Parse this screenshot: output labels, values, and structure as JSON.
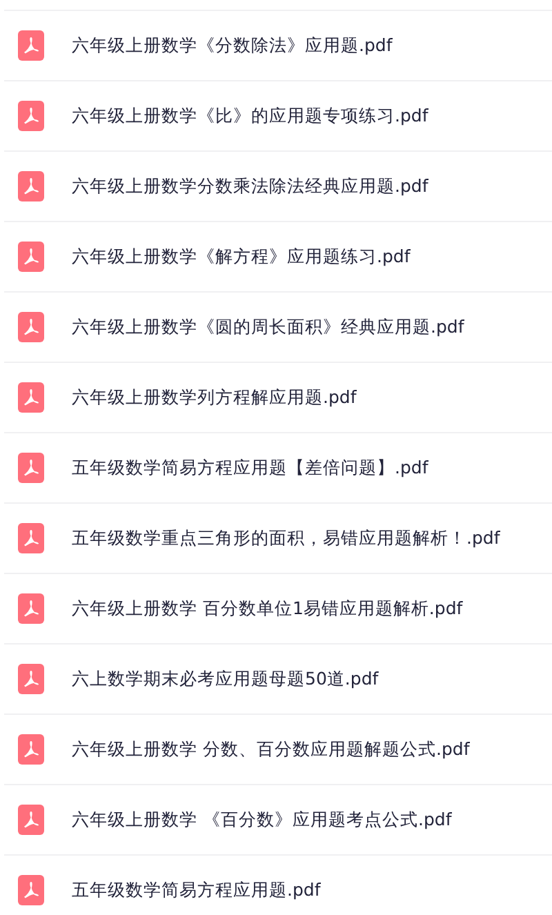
{
  "files": [
    {
      "name": "六年级上册数学《分数除法》应用题.pdf",
      "kind": "pdf"
    },
    {
      "name": "六年级上册数学《比》的应用题专项练习.pdf",
      "kind": "pdf"
    },
    {
      "name": "六年级上册数学分数乘法除法经典应用题.pdf",
      "kind": "pdf"
    },
    {
      "name": "六年级上册数学《解方程》应用题练习.pdf",
      "kind": "pdf"
    },
    {
      "name": "六年级上册数学《圆的周长面积》经典应用题.pdf",
      "kind": "pdf"
    },
    {
      "name": "六年级上册数学列方程解应用题.pdf",
      "kind": "pdf"
    },
    {
      "name": "五年级数学简易方程应用题【差倍问题】.pdf",
      "kind": "pdf"
    },
    {
      "name": "五年级数学重点三角形的面积，易错应用题解析！.pdf",
      "kind": "pdf"
    },
    {
      "name": "六年级上册数学 百分数单位1易错应用题解析.pdf",
      "kind": "pdf"
    },
    {
      "name": "六上数学期末必考应用题母题50道.pdf",
      "kind": "pdf"
    },
    {
      "name": "六年级上册数学 分数、百分数应用题解题公式.pdf",
      "kind": "pdf"
    },
    {
      "name": "六年级上册数学 《百分数》应用题考点公式.pdf",
      "kind": "pdf"
    },
    {
      "name": "五年级数学简易方程应用题.pdf",
      "kind": "pdf"
    }
  ]
}
